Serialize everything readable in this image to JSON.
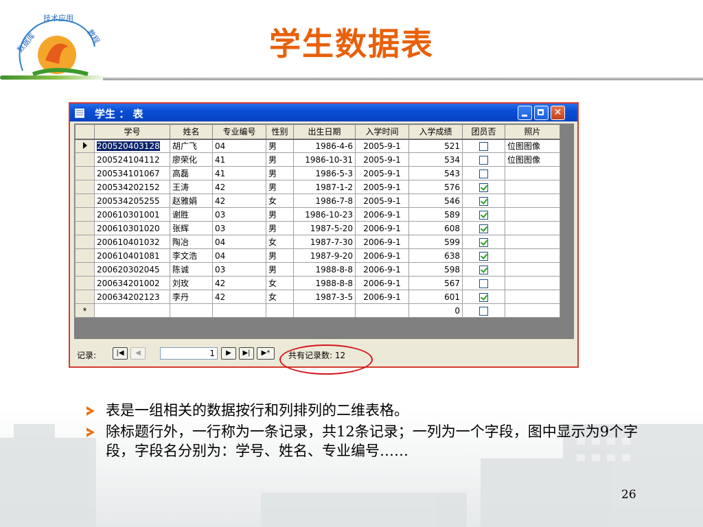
{
  "slide": {
    "title": "学生数据表",
    "logo_text": "数据库技术应用教程",
    "page_number": "26",
    "bullets": [
      "表是一组相关的数据按行和列排列的二维表格。",
      "除标题行外，一行称为一条记录，共12条记录；一列为一个字段，图中显示为9个字段，字段名分别为：学号、姓名、专业编号……"
    ]
  },
  "window": {
    "title": "学生 ： 表",
    "buttons": [
      "minimize-button",
      "maximize-button",
      "close-button"
    ]
  },
  "table": {
    "columns": [
      "学号",
      "姓名",
      "专业编号",
      "性别",
      "出生日期",
      "入学时间",
      "入学成绩",
      "团员否",
      "照片"
    ],
    "rows": [
      {
        "id": "200520403128",
        "name": "胡广飞",
        "major": "04",
        "sex": "男",
        "birth": "1986-4-6",
        "enroll": "2005-9-1",
        "score": "521",
        "member": false,
        "photo": "位图图像"
      },
      {
        "id": "200524104112",
        "name": "廖荣化",
        "major": "41",
        "sex": "男",
        "birth": "1986-10-31",
        "enroll": "2005-9-1",
        "score": "534",
        "member": false,
        "photo": "位图图像"
      },
      {
        "id": "200534101067",
        "name": "高磊",
        "major": "41",
        "sex": "男",
        "birth": "1986-5-3",
        "enroll": "2005-9-1",
        "score": "543",
        "member": false,
        "photo": ""
      },
      {
        "id": "200534202152",
        "name": "王涛",
        "major": "42",
        "sex": "男",
        "birth": "1987-1-2",
        "enroll": "2005-9-1",
        "score": "576",
        "member": true,
        "photo": ""
      },
      {
        "id": "200534205255",
        "name": "赵雅娟",
        "major": "42",
        "sex": "女",
        "birth": "1986-7-8",
        "enroll": "2005-9-1",
        "score": "546",
        "member": true,
        "photo": ""
      },
      {
        "id": "200610301001",
        "name": "谢胜",
        "major": "03",
        "sex": "男",
        "birth": "1986-10-23",
        "enroll": "2006-9-1",
        "score": "589",
        "member": true,
        "photo": ""
      },
      {
        "id": "200610301020",
        "name": "张辉",
        "major": "03",
        "sex": "男",
        "birth": "1987-5-20",
        "enroll": "2006-9-1",
        "score": "608",
        "member": true,
        "photo": ""
      },
      {
        "id": "200610401032",
        "name": "陶冶",
        "major": "04",
        "sex": "女",
        "birth": "1987-7-30",
        "enroll": "2006-9-1",
        "score": "599",
        "member": true,
        "photo": ""
      },
      {
        "id": "200610401081",
        "name": "李文浩",
        "major": "04",
        "sex": "男",
        "birth": "1987-9-20",
        "enroll": "2006-9-1",
        "score": "638",
        "member": true,
        "photo": ""
      },
      {
        "id": "200620302045",
        "name": "陈诚",
        "major": "03",
        "sex": "男",
        "birth": "1988-8-8",
        "enroll": "2006-9-1",
        "score": "598",
        "member": true,
        "photo": ""
      },
      {
        "id": "200634201002",
        "name": "刘玫",
        "major": "42",
        "sex": "女",
        "birth": "1988-8-8",
        "enroll": "2006-9-1",
        "score": "567",
        "member": false,
        "photo": ""
      },
      {
        "id": "200634202123",
        "name": "李丹",
        "major": "42",
        "sex": "女",
        "birth": "1987-3-5",
        "enroll": "2006-9-1",
        "score": "601",
        "member": true,
        "photo": ""
      }
    ],
    "new_row": {
      "marker": "*",
      "score": "0",
      "member": false
    }
  },
  "navigator": {
    "label": "记录:",
    "current_record": "1",
    "count_text": "共有记录数: 12"
  },
  "colors": {
    "title": "#e8600a",
    "titlebar": "#0a4fd6",
    "highlight_ellipse": "#d2151b",
    "bullet_arrow": "#e87316"
  }
}
